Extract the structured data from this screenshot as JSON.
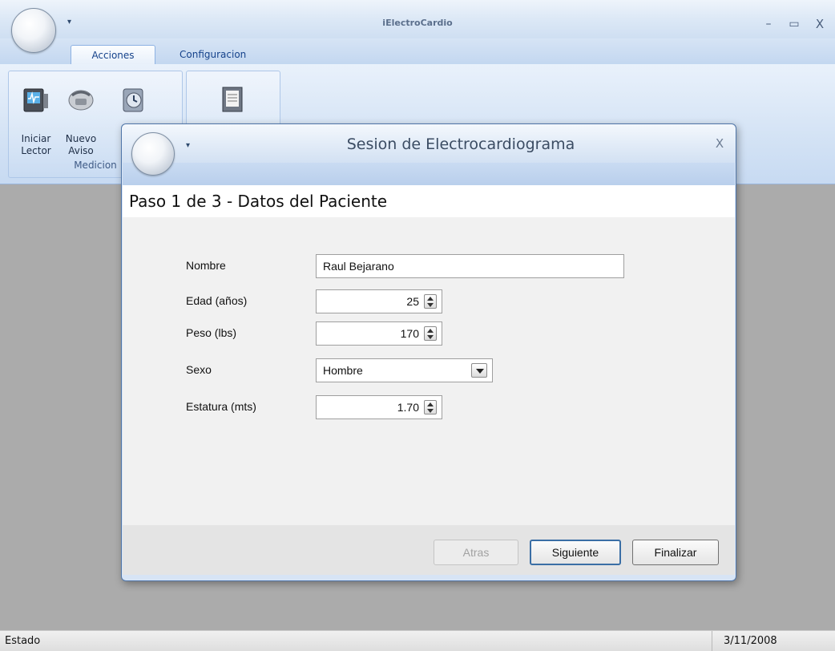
{
  "app": {
    "title": "iElectroCardio",
    "qat_glyph": "▾",
    "window_controls": {
      "minimize": "–",
      "maximize": "▭",
      "close": "X"
    }
  },
  "ribbon": {
    "tabs": [
      {
        "label": "Acciones",
        "active": true
      },
      {
        "label": "Configuracion",
        "active": false
      }
    ],
    "groups": [
      {
        "label": "Medicion",
        "buttons": [
          {
            "label": "Iniciar\nLector",
            "icon": "ecg-reader-icon"
          },
          {
            "label": "Nuevo\nAviso",
            "icon": "new-alert-icon"
          },
          {
            "label": "",
            "icon": "history-icon"
          }
        ]
      },
      {
        "label": "",
        "buttons": [
          {
            "label": "",
            "icon": "report-icon"
          }
        ]
      }
    ]
  },
  "dialog": {
    "title": "Sesion de Electrocardiograma",
    "close_glyph": "X",
    "qat_glyph": "▾",
    "step_title": "Paso 1 de 3 - Datos del Paciente",
    "fields": {
      "nombre": {
        "label": "Nombre",
        "value": "Raul Bejarano"
      },
      "edad": {
        "label": "Edad (años)",
        "value": "25"
      },
      "peso": {
        "label": "Peso (lbs)",
        "value": "170"
      },
      "sexo": {
        "label": "Sexo",
        "value": "Hombre"
      },
      "estatura": {
        "label": "Estatura (mts)",
        "value": "1.70"
      }
    },
    "buttons": {
      "atras": {
        "label": "Atras",
        "enabled": false
      },
      "siguiente": {
        "label": "Siguiente",
        "enabled": true
      },
      "finalizar": {
        "label": "Finalizar",
        "enabled": true
      }
    }
  },
  "status_bar": {
    "text": "Estado",
    "date": "3/11/2008"
  },
  "colors": {
    "ribbon_text": "#15428b",
    "workspace": "#ababab",
    "dialog_frame": "#4f75a8",
    "default_button_border": "#3a6ea5"
  }
}
